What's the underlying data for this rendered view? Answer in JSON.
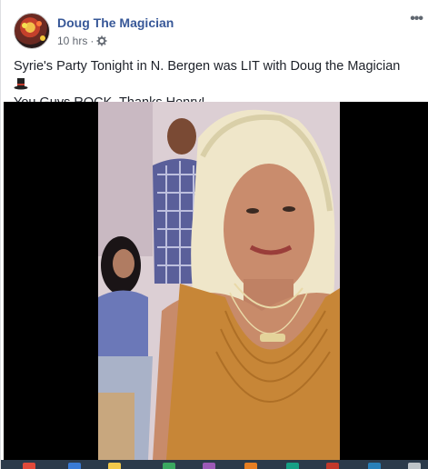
{
  "post": {
    "author": "Doug The Magician",
    "time": "10 hrs",
    "separator": "·",
    "privacy_icon": "gear-icon",
    "more_label": "•••",
    "message_line1": "Syrie's Party Tonight in N. Bergen was LIT with Doug the Magician",
    "message_line2": "You Guys ROCK. Thanks Henry!",
    "emoji_icon": "top-hat-icon"
  },
  "colors": {
    "author_link": "#385898",
    "meta_text": "#616770",
    "video_background": "#000000"
  }
}
